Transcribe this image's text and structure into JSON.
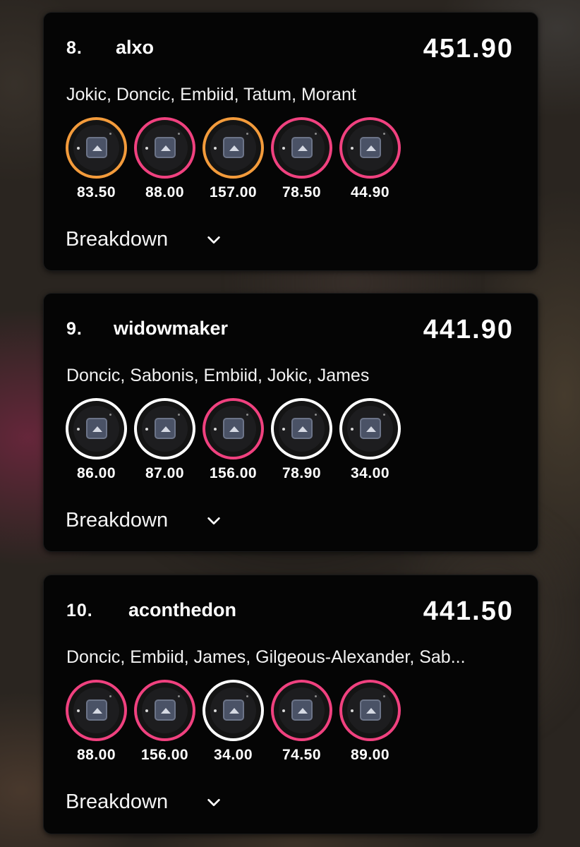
{
  "entries": [
    {
      "rank": "8.",
      "username": "alxo",
      "total": "451.90",
      "players": "Jokic, Doncic, Embiid, Tatum, Morant",
      "picks": [
        {
          "score": "83.50",
          "ring_color": "orange"
        },
        {
          "score": "88.00",
          "ring_color": "pink"
        },
        {
          "score": "157.00",
          "ring_color": "orange"
        },
        {
          "score": "78.50",
          "ring_color": "pink"
        },
        {
          "score": "44.90",
          "ring_color": "pink"
        }
      ],
      "breakdown_label": "Breakdown"
    },
    {
      "rank": "9.",
      "username": "widowmaker",
      "total": "441.90",
      "players": "Doncic, Sabonis, Embiid, Jokic, James",
      "picks": [
        {
          "score": "86.00",
          "ring_color": "white"
        },
        {
          "score": "87.00",
          "ring_color": "white"
        },
        {
          "score": "156.00",
          "ring_color": "pink"
        },
        {
          "score": "78.90",
          "ring_color": "white"
        },
        {
          "score": "34.00",
          "ring_color": "white"
        }
      ],
      "breakdown_label": "Breakdown"
    },
    {
      "rank": "10.",
      "username": "aconthedon",
      "total": "441.50",
      "players": "Doncic, Embiid, James, Gilgeous-Alexander, Sab...",
      "picks": [
        {
          "score": "88.00",
          "ring_color": "pink"
        },
        {
          "score": "156.00",
          "ring_color": "pink"
        },
        {
          "score": "34.00",
          "ring_color": "white"
        },
        {
          "score": "74.50",
          "ring_color": "pink"
        },
        {
          "score": "89.00",
          "ring_color": "pink"
        }
      ],
      "breakdown_label": "Breakdown"
    }
  ],
  "colors": {
    "orange_ring": "#f39b3b",
    "pink_ring": "#f0417f",
    "white_ring": "#ffffff",
    "card_background": "#050505"
  },
  "icons": {
    "avatar_placeholder": "image-placeholder-icon",
    "breakdown_toggle": "chevron-down-icon"
  }
}
